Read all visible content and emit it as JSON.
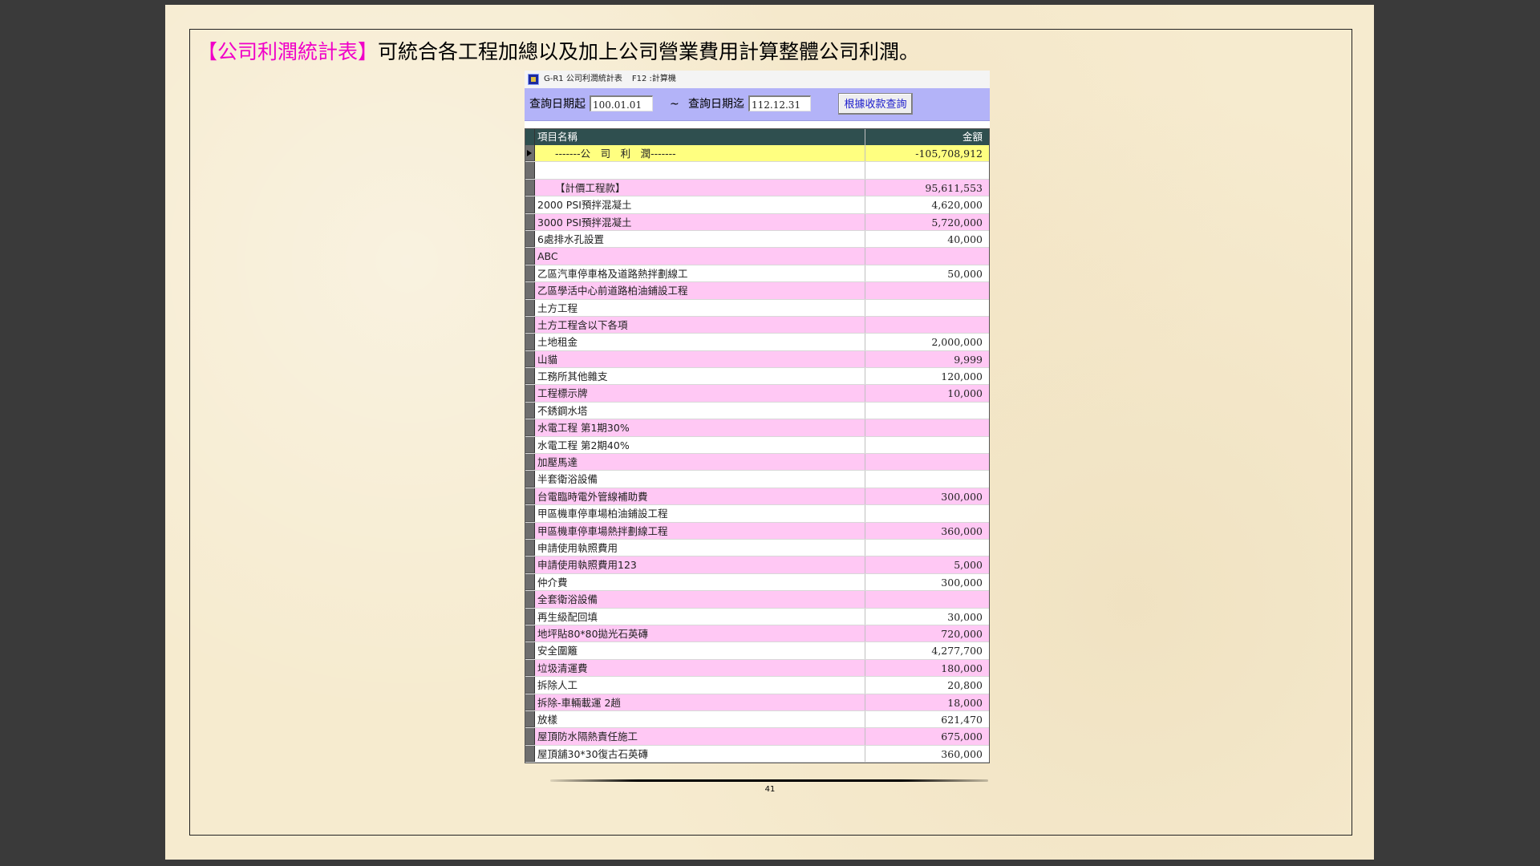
{
  "heading": {
    "highlight": "【公司利潤統計表】",
    "text": "可統合各工程加總以及加上公司營業費用計算整體公司利潤。"
  },
  "window": {
    "title": "G-R1 公司利潤統計表",
    "shortcut": "F12 :計算機",
    "icon": "app-icon"
  },
  "query": {
    "start_label": "查詢日期起",
    "start_value": "100.01.01",
    "tilde": "~",
    "end_label": "查詢日期迄",
    "end_value": "112.12.31",
    "button_label": "根據收款查詢"
  },
  "grid": {
    "columns": [
      "項目名稱",
      "金額"
    ],
    "rows": [
      {
        "name": "-------公　司　利　潤-------",
        "amount": "-105,708,912",
        "style": "yellow",
        "current": true
      },
      {
        "name": "",
        "amount": "",
        "style": "white"
      },
      {
        "name": "【計價工程款】",
        "amount": "95,611,553",
        "style": "pink"
      },
      {
        "name": "2000 PSI預拌混凝土",
        "amount": "4,620,000",
        "style": "white"
      },
      {
        "name": "3000 PSI預拌混凝土",
        "amount": "5,720,000",
        "style": "pink"
      },
      {
        "name": "6處排水孔設置",
        "amount": "40,000",
        "style": "white"
      },
      {
        "name": "ABC",
        "amount": "",
        "style": "pink"
      },
      {
        "name": "乙區汽車停車格及道路熱拌劃線工",
        "amount": "50,000",
        "style": "white"
      },
      {
        "name": "乙區學活中心前道路柏油鋪設工程",
        "amount": "",
        "style": "pink"
      },
      {
        "name": "土方工程",
        "amount": "",
        "style": "white"
      },
      {
        "name": "土方工程含以下各項",
        "amount": "",
        "style": "pink"
      },
      {
        "name": "土地租金",
        "amount": "2,000,000",
        "style": "white"
      },
      {
        "name": "山貓",
        "amount": "9,999",
        "style": "pink"
      },
      {
        "name": "工務所其他雜支",
        "amount": "120,000",
        "style": "white"
      },
      {
        "name": "工程標示牌",
        "amount": "10,000",
        "style": "pink"
      },
      {
        "name": "不銹鋼水塔",
        "amount": "",
        "style": "white"
      },
      {
        "name": "水電工程 第1期30%",
        "amount": "",
        "style": "pink"
      },
      {
        "name": "水電工程 第2期40%",
        "amount": "",
        "style": "white"
      },
      {
        "name": "加壓馬達",
        "amount": "",
        "style": "pink"
      },
      {
        "name": "半套衛浴設備",
        "amount": "",
        "style": "white"
      },
      {
        "name": "台電臨時電外管線補助費",
        "amount": "300,000",
        "style": "pink"
      },
      {
        "name": "甲區機車停車場柏油鋪設工程",
        "amount": "",
        "style": "white"
      },
      {
        "name": "甲區機車停車場熱拌劃線工程",
        "amount": "360,000",
        "style": "pink"
      },
      {
        "name": "申請使用執照費用",
        "amount": "",
        "style": "white"
      },
      {
        "name": "申請使用執照費用123",
        "amount": "5,000",
        "style": "pink"
      },
      {
        "name": "仲介費",
        "amount": "300,000",
        "style": "white"
      },
      {
        "name": "全套衛浴設備",
        "amount": "",
        "style": "pink"
      },
      {
        "name": "再生級配回填",
        "amount": "30,000",
        "style": "white"
      },
      {
        "name": "地坪貼80*80拋光石英磚",
        "amount": "720,000",
        "style": "pink"
      },
      {
        "name": "安全圍籬",
        "amount": "4,277,700",
        "style": "white"
      },
      {
        "name": "垃圾清運費",
        "amount": "180,000",
        "style": "pink"
      },
      {
        "name": "拆除人工",
        "amount": "20,800",
        "style": "white"
      },
      {
        "name": "拆除-車輛載運 2趟",
        "amount": "18,000",
        "style": "pink"
      },
      {
        "name": "放樣",
        "amount": "621,470",
        "style": "white"
      },
      {
        "name": "屋頂防水隔熱責任施工",
        "amount": "675,000",
        "style": "pink"
      },
      {
        "name": "屋頂舖30*30復古石英磚",
        "amount": "360,000",
        "style": "white"
      }
    ]
  },
  "page_number": "41"
}
